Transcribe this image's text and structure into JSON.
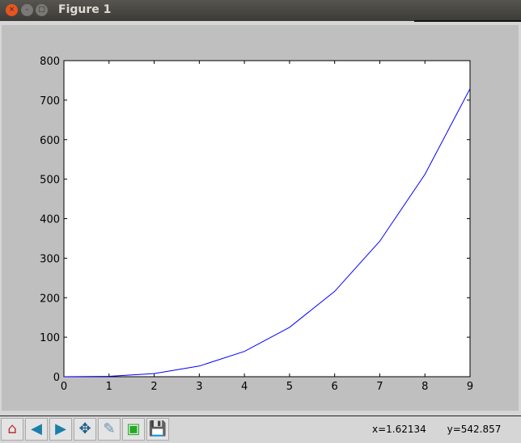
{
  "window": {
    "title": "Figure 1"
  },
  "toolbar": {
    "buttons": [
      "home-icon",
      "back-icon",
      "forward-icon",
      "pan-icon",
      "zoom-rect-icon",
      "subplots-icon",
      "save-icon"
    ],
    "x_readout": "x=1.62134",
    "y_readout": "y=542.857"
  },
  "colors": {
    "line": "#0000ff",
    "figure_bg": "#bfbfbf"
  },
  "chart_data": {
    "type": "line",
    "title": "",
    "xlabel": "",
    "ylabel": "",
    "x": [
      0,
      1,
      2,
      3,
      4,
      5,
      6,
      7,
      8,
      9
    ],
    "series": [
      {
        "name": "y",
        "values": [
          0,
          1,
          8,
          27,
          64,
          125,
          216,
          343,
          512,
          729
        ]
      }
    ],
    "xlim": [
      0,
      9
    ],
    "ylim": [
      0,
      800
    ],
    "xticks": [
      "0",
      "1",
      "2",
      "3",
      "4",
      "5",
      "6",
      "7",
      "8",
      "9"
    ],
    "yticks": [
      "0",
      "100",
      "200",
      "300",
      "400",
      "500",
      "600",
      "700",
      "800"
    ],
    "grid": false
  }
}
